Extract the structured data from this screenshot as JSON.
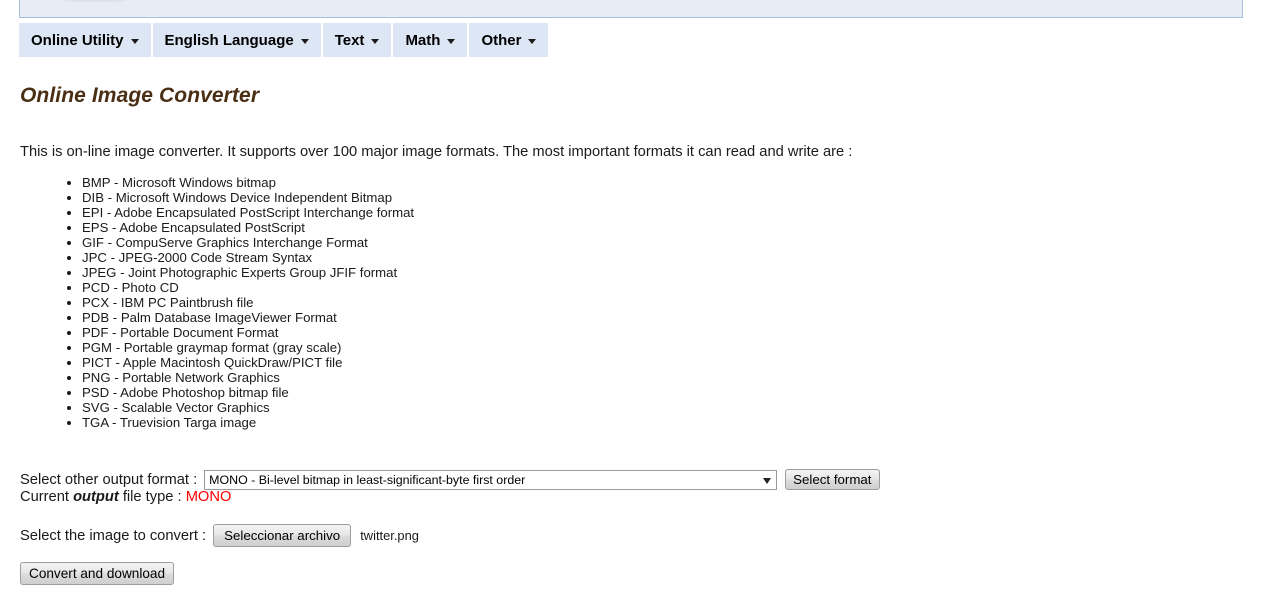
{
  "banner": {
    "logo_icon": "site-logo-image"
  },
  "nav": {
    "items": [
      {
        "label": "Online Utility",
        "caret": "chevron-down-icon"
      },
      {
        "label": "English Language",
        "caret": "chevron-down-icon"
      },
      {
        "label": "Text",
        "caret": "chevron-down-icon"
      },
      {
        "label": "Math",
        "caret": "chevron-down-icon"
      },
      {
        "label": "Other",
        "caret": "chevron-down-icon"
      }
    ]
  },
  "page": {
    "title": "Online Image Converter",
    "intro": "This is on-line image converter. It supports over 100 major image formats. The most important formats it can read and write are :"
  },
  "formats": [
    "BMP - Microsoft Windows bitmap",
    "DIB - Microsoft Windows Device Independent Bitmap",
    "EPI - Adobe Encapsulated PostScript Interchange format",
    "EPS - Adobe Encapsulated PostScript",
    "GIF - CompuServe Graphics Interchange Format",
    "JPC - JPEG-2000 Code Stream Syntax",
    "JPEG - Joint Photographic Experts Group JFIF format",
    "PCD - Photo CD",
    "PCX - IBM PC Paintbrush file",
    "PDB - Palm Database ImageViewer Format",
    "PDF - Portable Document Format",
    "PGM - Portable graymap format (gray scale)",
    "PICT - Apple Macintosh QuickDraw/PICT file",
    "PNG - Portable Network Graphics",
    "PSD - Adobe Photoshop bitmap file",
    "SVG - Scalable Vector Graphics",
    "TGA - Truevision Targa image"
  ],
  "form": {
    "output_format_label": "Select other output format :",
    "output_format_selected": "MONO - Bi-level bitmap in least-significant-byte first order",
    "select_format_button": "Select format",
    "current_type_prefix": "Current ",
    "current_type_bold": "output",
    "current_type_suffix": " file type : ",
    "current_type_value": "MONO",
    "file_label": "Select the image to convert :",
    "file_choose_button": "Seleccionar archivo",
    "file_name": "twitter.png",
    "convert_button": "Convert and download"
  },
  "colors": {
    "nav_background": "#dce6f5",
    "banner_background": "#e8ecf5",
    "banner_border": "#a8c0e0",
    "title": "#4a2f15",
    "accent_red": "#ff0000"
  }
}
